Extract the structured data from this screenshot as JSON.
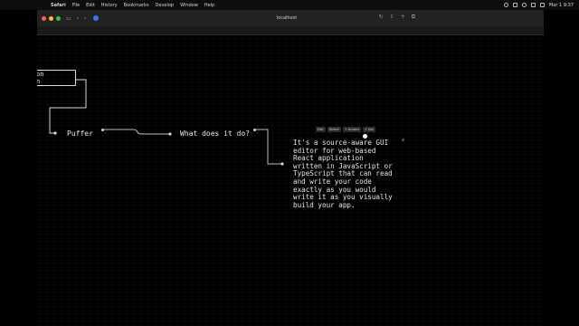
{
  "menubar": {
    "app_name": "Safari",
    "items": [
      "File",
      "Edit",
      "History",
      "Bookmarks",
      "Develop",
      "Window",
      "Help"
    ],
    "clock": "Mar 1  9:37"
  },
  "browser": {
    "address": "localhost"
  },
  "canvas": {
    "top_node_lines": [
      "on",
      "n"
    ],
    "nodes": {
      "puffer": "Puffer",
      "question": "What does it do?"
    },
    "answer": "It's a source-aware GUI\neditor for web-based\nReact application\nwritten in JavaScript or\nTypeScript that can read\nand write your code\nexactly as you would\nwrite it as you visually\nbuild your app.",
    "node_toolbar": [
      "Edit",
      "Delete",
      "+ Answer",
      "+ Ask"
    ]
  }
}
